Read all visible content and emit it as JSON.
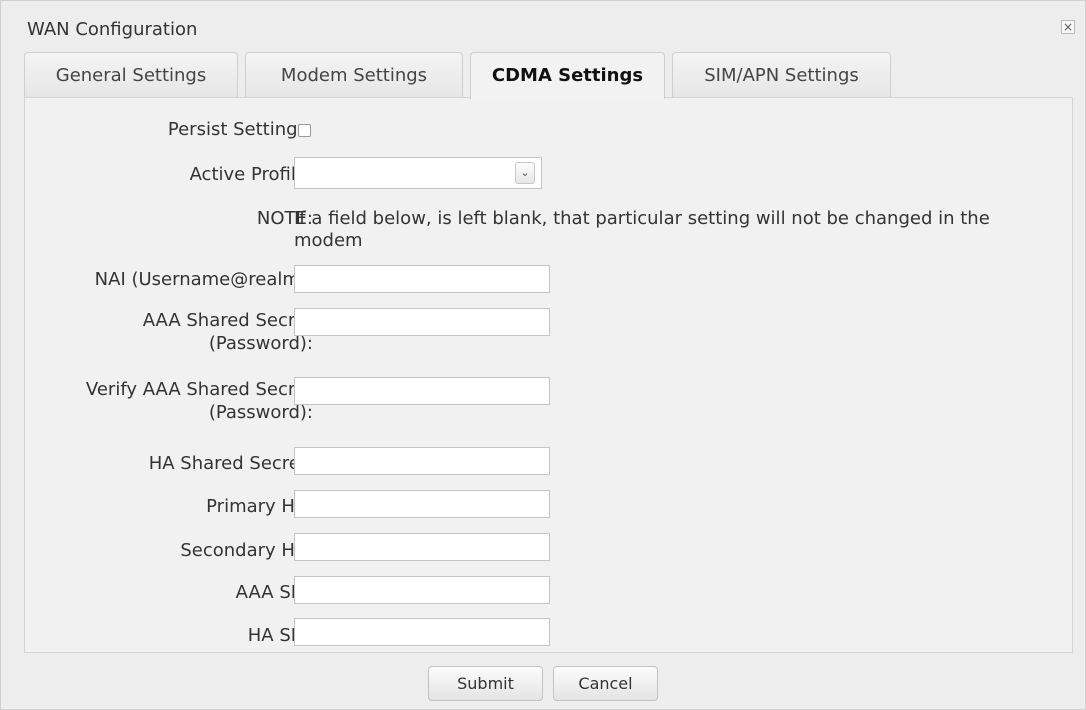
{
  "dialog": {
    "title": "WAN Configuration",
    "close_glyph": "×",
    "close_icon": "close-icon"
  },
  "tabs": [
    {
      "label": "General Settings",
      "active": false
    },
    {
      "label": "Modem Settings",
      "active": false
    },
    {
      "label": "CDMA Settings",
      "active": true
    },
    {
      "label": "SIM/APN Settings",
      "active": false
    }
  ],
  "form": {
    "persist_label": "Persist Settings:",
    "persist_checked": false,
    "active_profile_label": "Active Profile:",
    "active_profile_value": "",
    "dropdown_glyph": "⌄",
    "dropdown_icon": "chevron-down-icon",
    "note_label": "NOTE:",
    "note_text": "If a field below, is left blank, that particular setting will not be changed in the modem",
    "nai_label": "NAI (Username@realm):",
    "nai_value": "",
    "aaa_secret_label_line1": "AAA Shared Secret",
    "aaa_secret_label_line2": "(Password):",
    "aaa_secret_value": "",
    "verify_aaa_label_line1": "Verify AAA Shared Secret",
    "verify_aaa_label_line2": "(Password):",
    "verify_aaa_value": "",
    "ha_secret_label": "HA Shared Secret:",
    "ha_secret_value": "",
    "primary_ha_label": "Primary HA:",
    "primary_ha_value": "",
    "secondary_ha_label": "Secondary HA:",
    "secondary_ha_value": "",
    "aaa_spi_label": "AAA SPI:",
    "aaa_spi_value": "",
    "ha_spi_label": "HA SPI:",
    "ha_spi_value": ""
  },
  "footer": {
    "submit_label": "Submit",
    "cancel_label": "Cancel"
  }
}
